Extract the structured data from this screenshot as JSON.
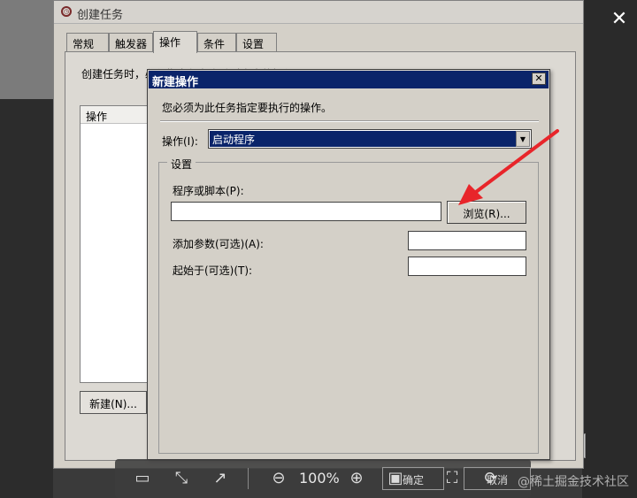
{
  "task_window": {
    "title": "创建任务",
    "tabs": [
      "常规",
      "触发器",
      "操作",
      "条件",
      "设置"
    ],
    "active_tab": "操作",
    "description": "创建任务时，必须指定任务启动时发生的操作。",
    "actions_column_header": "操作",
    "new_button": "新建(N)...",
    "cancel_button": "取消"
  },
  "dialog": {
    "title": "新建操作",
    "close_glyph": "✕",
    "description": "您必须为此任务指定要执行的操作。",
    "action_label": "操作(I):",
    "action_value": "启动程序",
    "settings_legend": "设置",
    "program_label": "程序或脚本(P):",
    "program_value": "",
    "browse_button": "浏览(R)...",
    "args_label": "添加参数(可选)(A):",
    "args_value": "",
    "start_in_label": "起始于(可选)(T):",
    "start_in_value": ""
  },
  "viewer_toolbar": {
    "zoom": "100%",
    "ok_button": "确定",
    "cancel_button": "取消",
    "icons": [
      "save-icon",
      "fit-screen-icon",
      "share-icon",
      "zoom-out-icon",
      "zoom-in-icon",
      "original-size-icon",
      "fullscreen-icon",
      "rotate-icon"
    ]
  },
  "overlay": {
    "close_glyph": "✕",
    "watermark": "@稀土掘金技术社区",
    "annotation_color": "#e8252a"
  }
}
